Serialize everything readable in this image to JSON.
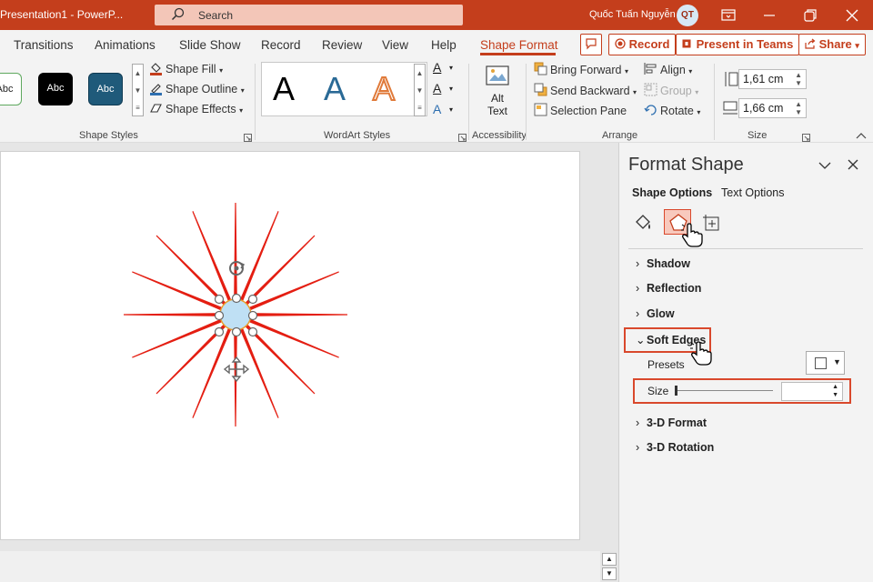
{
  "titlebar": {
    "title": "Presentation1  -  PowerP...",
    "search_placeholder": "Search",
    "user_name": "Quốc Tuấn Nguyễn",
    "avatar_initials": "QT"
  },
  "tabs": [
    "Transitions",
    "Animations",
    "Slide Show",
    "Record",
    "Review",
    "View",
    "Help",
    "Shape Format"
  ],
  "header_buttons": {
    "record": "Record",
    "present_in_teams": "Present in Teams",
    "share": "Share"
  },
  "ribbon": {
    "shape_styles": {
      "sample_label": "Abc",
      "fill": "Shape Fill",
      "outline": "Shape Outline",
      "effects": "Shape Effects",
      "label": "Shape Styles"
    },
    "wordart": {
      "sample_letter": "A",
      "label": "WordArt Styles"
    },
    "accessibility": {
      "alt_text_line1": "Alt",
      "alt_text_line2": "Text",
      "label": "Accessibility"
    },
    "arrange": {
      "bring_forward": "Bring Forward",
      "send_backward": "Send Backward",
      "selection_pane": "Selection Pane",
      "align": "Align",
      "group": "Group",
      "rotate": "Rotate",
      "label": "Arrange"
    },
    "size": {
      "height": "1,61 cm",
      "width": "1,66 cm",
      "label": "Size"
    }
  },
  "pane": {
    "title": "Format Shape",
    "tab_shape_options": "Shape Options",
    "tab_text_options": "Text Options",
    "sections": {
      "shadow": "Shadow",
      "reflection": "Reflection",
      "glow": "Glow",
      "soft_edges": "Soft Edges",
      "format_3d": "3-D Format",
      "rotation_3d": "3-D Rotation"
    },
    "presets_label": "Presets",
    "size_label": "Size",
    "size_value": ""
  },
  "colors": {
    "accent": "#c43e1c",
    "highlight": "#d9482c",
    "star_ray": "#e41e12",
    "shape_style_dark": "#1f5a7a"
  }
}
